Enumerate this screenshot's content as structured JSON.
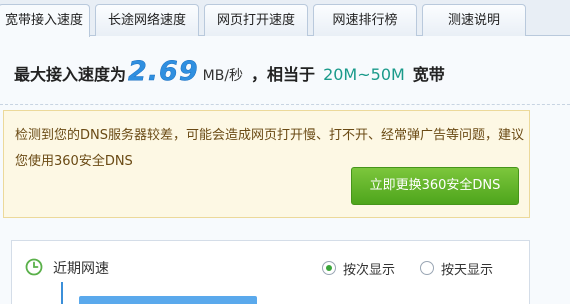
{
  "tabs": [
    {
      "label": "宽带接入速度",
      "active": true
    },
    {
      "label": "长途网络速度",
      "active": false
    },
    {
      "label": "网页打开速度",
      "active": false
    },
    {
      "label": "网速排行榜",
      "active": false
    },
    {
      "label": "测速说明",
      "active": false
    }
  ],
  "speed": {
    "prefix": "最大接入速度为",
    "value": "2.69",
    "unit": "MB/秒",
    "equiv_label": "，相当于",
    "range": "20M~50M",
    "bandwidth_label": "宽带"
  },
  "warning": {
    "text": "检测到您的DNS服务器较差，可能会造成网页打开慢、打不开、经常弹广告等问题，建议您使用360安全DNS",
    "button_label": "立即更换360安全DNS"
  },
  "recent": {
    "title": "近期网速",
    "options": [
      {
        "label": "按次显示",
        "selected": true
      },
      {
        "label": "按天显示",
        "selected": false
      }
    ]
  },
  "colors": {
    "speed_value": "#2f8fe0",
    "range": "#1a9a8a",
    "button_green": "#4ea51c",
    "warning_bg": "#fdf8e4"
  }
}
